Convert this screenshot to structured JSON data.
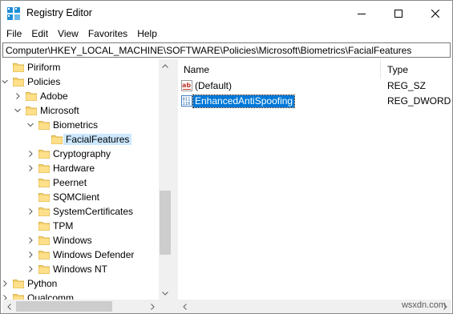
{
  "window": {
    "title": "Registry Editor",
    "app_icon": "registry-editor-icon",
    "controls": [
      "minimize-icon",
      "maximize-icon",
      "close-icon"
    ]
  },
  "menu": {
    "items": [
      "File",
      "Edit",
      "View",
      "Favorites",
      "Help"
    ]
  },
  "address": {
    "path": "Computer\\HKEY_LOCAL_MACHINE\\SOFTWARE\\Policies\\Microsoft\\Biometrics\\FacialFeatures"
  },
  "tree": {
    "items": [
      {
        "label": "Piriform",
        "expander": "none",
        "selected": false
      },
      {
        "label": "Policies",
        "expander": "expanded",
        "selected": false
      },
      {
        "label": "Adobe",
        "expander": "collapsed",
        "selected": false
      },
      {
        "label": "Microsoft",
        "expander": "expanded",
        "selected": false
      },
      {
        "label": "Biometrics",
        "expander": "expanded",
        "selected": false
      },
      {
        "label": "FacialFeatures",
        "expander": "none",
        "selected": true
      },
      {
        "label": "Cryptography",
        "expander": "collapsed",
        "selected": false
      },
      {
        "label": "Hardware",
        "expander": "collapsed",
        "selected": false
      },
      {
        "label": "Peernet",
        "expander": "none",
        "selected": false
      },
      {
        "label": "SQMClient",
        "expander": "none",
        "selected": false
      },
      {
        "label": "SystemCertificates",
        "expander": "collapsed",
        "selected": false
      },
      {
        "label": "TPM",
        "expander": "none",
        "selected": false
      },
      {
        "label": "Windows",
        "expander": "collapsed",
        "selected": false
      },
      {
        "label": "Windows Defender",
        "expander": "collapsed",
        "selected": false
      },
      {
        "label": "Windows NT",
        "expander": "collapsed",
        "selected": false
      },
      {
        "label": "Python",
        "expander": "collapsed",
        "selected": false
      },
      {
        "label": "Qualcomm",
        "expander": "collapsed",
        "selected": false
      }
    ]
  },
  "list": {
    "columns": {
      "name": "Name",
      "type": "Type"
    },
    "rows": [
      {
        "name": "(Default)",
        "type": "REG_SZ",
        "icon": "string-value-icon",
        "selected": false
      },
      {
        "name": "EnhancedAntiSpoofing",
        "type": "REG_DWORD",
        "icon": "binary-value-icon",
        "selected": true
      }
    ]
  },
  "watermark": "wsxdn.com",
  "colors": {
    "folder": "#f5d36e",
    "selection_focus": "#0078d7",
    "selection_tree": "#cce8ff"
  }
}
